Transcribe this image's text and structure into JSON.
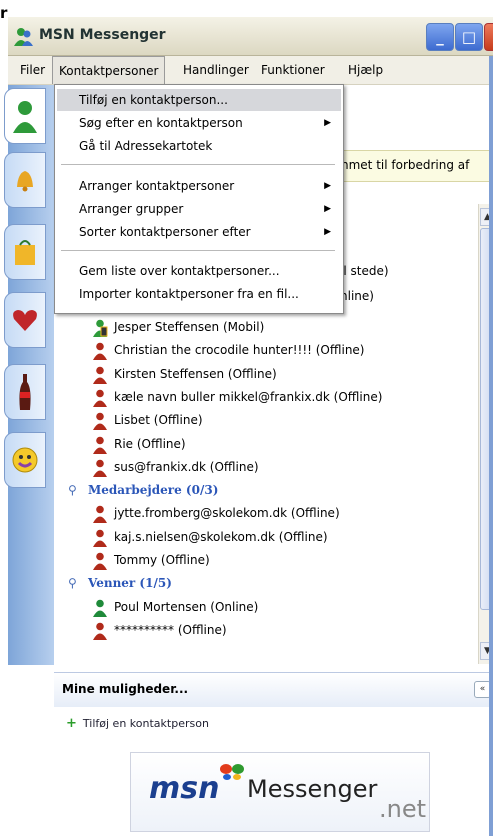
{
  "window": {
    "partial_letter": "r",
    "title": "MSN Messenger",
    "minimize": "_",
    "maximize": "□",
    "close": "X"
  },
  "menubar": {
    "items": [
      "Filer",
      "Kontaktpersoner",
      "Handlinger",
      "Funktioner",
      "Hjælp"
    ]
  },
  "dropdown": {
    "items": [
      {
        "label": "Tilføj en kontaktperson...",
        "submenu": false
      },
      {
        "label": "Søg efter en kontaktperson",
        "submenu": true
      },
      {
        "label": "Gå til Adressekartotek",
        "submenu": false
      },
      {
        "label": "Arranger kontaktpersoner",
        "submenu": true
      },
      {
        "label": "Arranger grupper",
        "submenu": true
      },
      {
        "label": "Sorter kontaktpersoner efter",
        "submenu": true
      },
      {
        "label": "Gem liste over kontaktpersoner...",
        "submenu": false
      },
      {
        "label": "Importer kontaktpersoner fra en fil...",
        "submenu": false
      }
    ],
    "arrow": "▶"
  },
  "notice": {
    "text": "nmet til forbedring af"
  },
  "peek": {
    "line1": "il stede)",
    "line2": "nline)"
  },
  "contacts": {
    "rows": [
      {
        "type": "contact",
        "text": "Jesper Steffensen (Mobil)",
        "status": "mobile"
      },
      {
        "type": "contact",
        "text": "Christian the crocodile hunter!!!! (Offline)",
        "status": "offline"
      },
      {
        "type": "contact",
        "text": "Kirsten Steffensen (Offline)",
        "status": "offline"
      },
      {
        "type": "contact",
        "text": "kæle navn buller mikkel@frankix.dk (Offline)",
        "status": "offline"
      },
      {
        "type": "contact",
        "text": "Lisbet (Offline)",
        "status": "offline"
      },
      {
        "type": "contact",
        "text": "Rie (Offline)",
        "status": "offline"
      },
      {
        "type": "contact",
        "text": "sus@frankix.dk (Offline)",
        "status": "offline"
      },
      {
        "type": "group",
        "text": "Medarbejdere (0/3)"
      },
      {
        "type": "contact",
        "text": "jytte.fromberg@skolekom.dk (Offline)",
        "status": "offline"
      },
      {
        "type": "contact",
        "text": "kaj.s.nielsen@skolekom.dk (Offline)",
        "status": "offline"
      },
      {
        "type": "contact",
        "text": "Tommy (Offline)",
        "status": "offline"
      },
      {
        "type": "group",
        "text": "Venner (1/5)"
      },
      {
        "type": "contact",
        "text": "Poul Mortensen (Online)",
        "status": "online"
      },
      {
        "type": "contact",
        "text": "********** (Offline)",
        "status": "offline"
      }
    ]
  },
  "options": {
    "title": "Mine muligheder...",
    "collapse": "«",
    "add_contact": "Tilføj en kontaktperson",
    "add_plus": "+"
  },
  "banner": {
    "msn": "msn",
    "messenger": "Messenger",
    "net": ".net"
  },
  "colors": {
    "offline": "#b02a1a",
    "online": "#1f8a3a",
    "group": "#2b56b8",
    "highlight": "#d6d7db"
  },
  "icons": {
    "scroll_up": "▲",
    "scroll_down": "▼"
  }
}
